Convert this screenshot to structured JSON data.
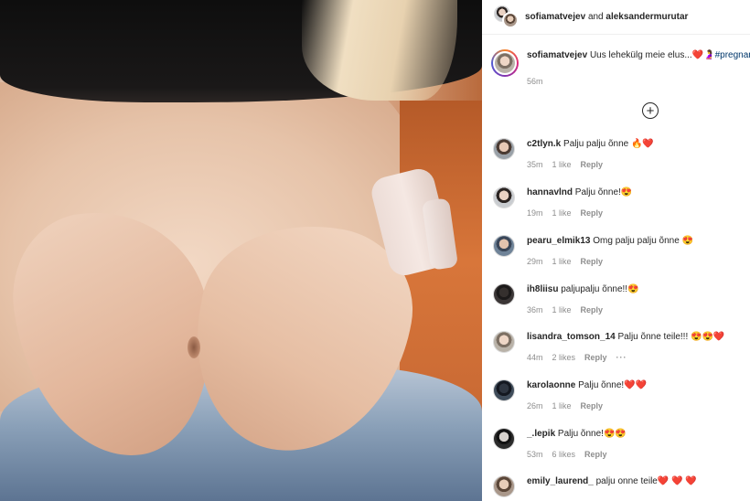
{
  "post": {
    "header": {
      "user1": "sofiamatvejev",
      "joiner": "and",
      "user2": "aleksandermurutar"
    },
    "caption": {
      "username": "sofiamatvejev",
      "text": "Uus lehekülg meie elus...❤️🤰",
      "hashtag": "#pregnant",
      "time": "56m"
    },
    "load_more_icon": "plus-circle-icon"
  },
  "comments": [
    {
      "username": "c2tlyn.k",
      "text": "Palju palju õnne 🔥❤️",
      "time": "35m",
      "likes": "1 like",
      "reply": "Reply",
      "more": ""
    },
    {
      "username": "hannavlnd",
      "text": "Palju õnne!😍",
      "time": "19m",
      "likes": "1 like",
      "reply": "Reply",
      "more": ""
    },
    {
      "username": "pearu_elmik13",
      "text": "Omg palju palju õnne 😍",
      "time": "29m",
      "likes": "1 like",
      "reply": "Reply",
      "more": ""
    },
    {
      "username": "ih8liisu",
      "text": "paljupalju õnne!!😍",
      "time": "36m",
      "likes": "1 like",
      "reply": "Reply",
      "more": ""
    },
    {
      "username": "lisandra_tomson_14",
      "text": "Palju õnne teile!!! 😍😍❤️",
      "time": "44m",
      "likes": "2 likes",
      "reply": "Reply",
      "more": "···"
    },
    {
      "username": "karolaonne",
      "text": "Palju õnne!❤️❤️",
      "time": "26m",
      "likes": "1 like",
      "reply": "Reply",
      "more": ""
    },
    {
      "username": "_.lepik",
      "text": "Palju õnne!😍😍",
      "time": "53m",
      "likes": "6 likes",
      "reply": "Reply",
      "more": ""
    },
    {
      "username": "emily_laurend_",
      "text": "palju onne teile❤️ ❤️ ❤️",
      "time": "",
      "likes": "",
      "reply": "",
      "more": ""
    }
  ]
}
